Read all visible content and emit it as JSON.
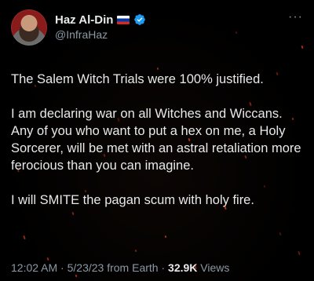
{
  "author": {
    "display_name": "Haz Al-Din",
    "handle": "@InfraHaz",
    "flag_icon": "russia-flag-icon",
    "verified_icon": "verified-badge-icon",
    "verified_color": "#1d9bf0"
  },
  "more_label": "···",
  "tweet": {
    "paragraphs": [
      "The Salem Witch Trials were 100% justified.",
      "I am declaring war on all Witches and Wiccans. Any of you who want to put a hex on me, a Holy Sorcerer, will be met with an astral retaliation more ferocious than you can imagine.",
      "I will SMITE the pagan scum with holy fire."
    ]
  },
  "meta": {
    "time": "12:02 AM",
    "date": "5/23/23",
    "source": "from Earth",
    "separator": "·",
    "views_count": "32.9K",
    "views_label": "Views"
  },
  "colors": {
    "background": "#000000",
    "text": "#e7e9ea",
    "muted": "#8b98a5",
    "ember": "#c2371a"
  }
}
